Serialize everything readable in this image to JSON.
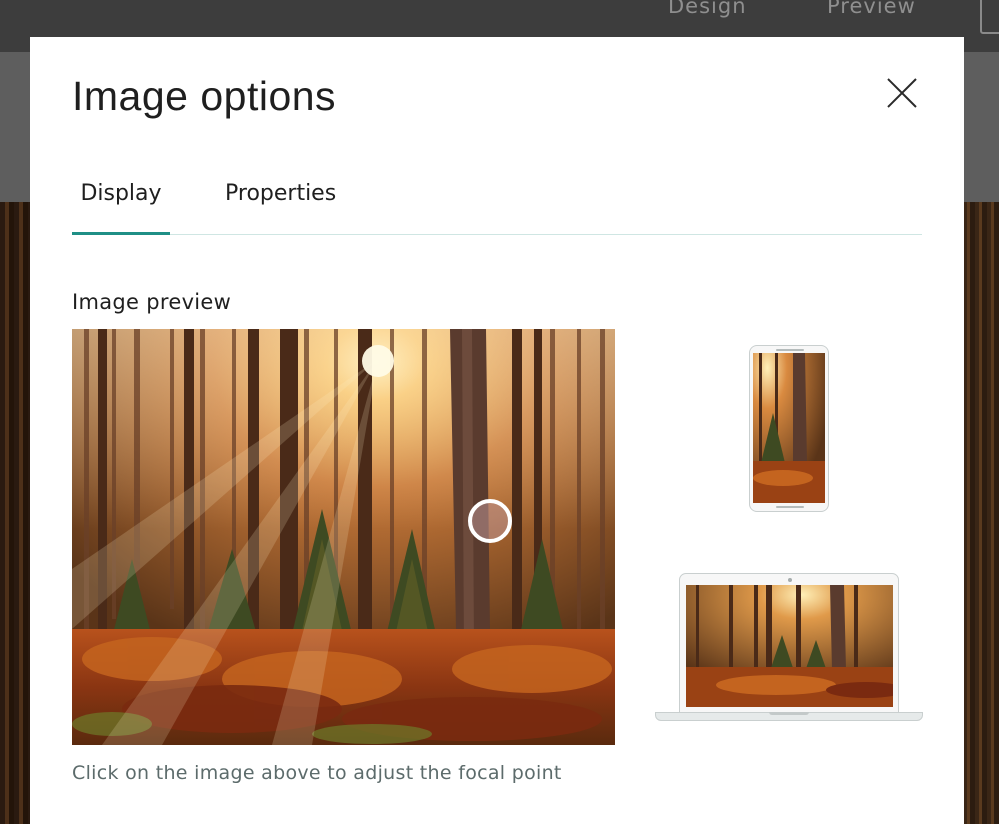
{
  "background": {
    "nav_design": "Design",
    "nav_preview": "Preview"
  },
  "modal": {
    "title": "Image options",
    "close_icon": "close-icon",
    "tabs": [
      {
        "label": "Display",
        "active": true
      },
      {
        "label": "Properties",
        "active": false
      }
    ],
    "section_label": "Image preview",
    "help_text": "Click on the image above to adjust the focal point",
    "accent_color": "#1f8f86"
  }
}
